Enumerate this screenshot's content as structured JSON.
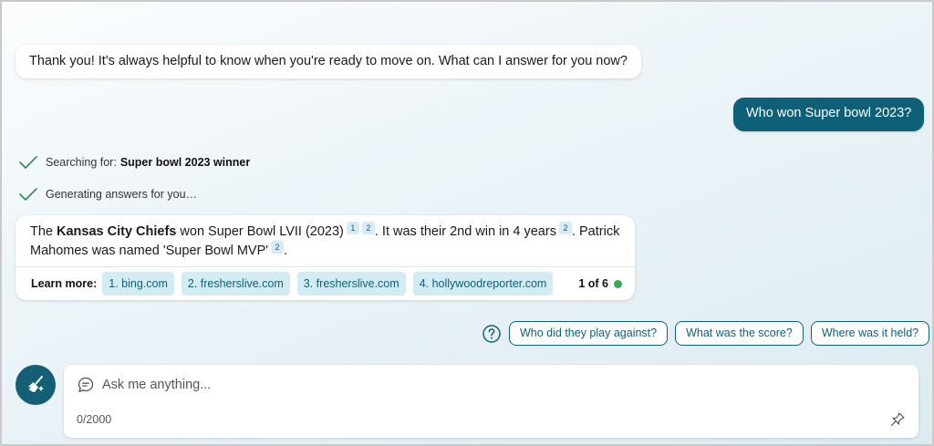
{
  "conversation": {
    "bot_message_1": "Thank you! It's always helpful to know when you're ready to move on. What can I answer for you now?",
    "user_message": "Who won Super bowl 2023?",
    "status": [
      {
        "prefix": "Searching for:",
        "bold": "Super bowl 2023 winner"
      },
      {
        "prefix": "Generating answers for you…",
        "bold": ""
      }
    ],
    "answer": {
      "part1": "The ",
      "bold": "Kansas City Chiefs",
      "part2": " won Super Bowl LVII (2023)",
      "cite_a": "1",
      "cite_b": "2",
      "part3": ". It was their 2nd win in 4 years",
      "cite_c": "2",
      "part4": ". Patrick Mahomes was named 'Super Bowl MVP'",
      "cite_d": "2",
      "part5": "."
    },
    "learn_more": {
      "label": "Learn more:",
      "links": [
        "1. bing.com",
        "2. fresherslive.com",
        "3. fresherslive.com",
        "4. hollywoodreporter.com"
      ],
      "count": "1 of 6",
      "dot_color": "#3aa655"
    }
  },
  "suggestions": [
    "Who did they play against?",
    "What was the score?",
    "Where was it held?"
  ],
  "input": {
    "placeholder": "Ask me anything...",
    "counter": "0/2000"
  },
  "colors": {
    "accent": "#0e5f78",
    "chip_bg": "#d3ecf4"
  },
  "icons": {
    "status": "checkmark-icon",
    "help": "question-circle-icon",
    "new_topic": "broom-icon",
    "chat": "chat-bubble-icon",
    "pin": "pin-icon"
  }
}
